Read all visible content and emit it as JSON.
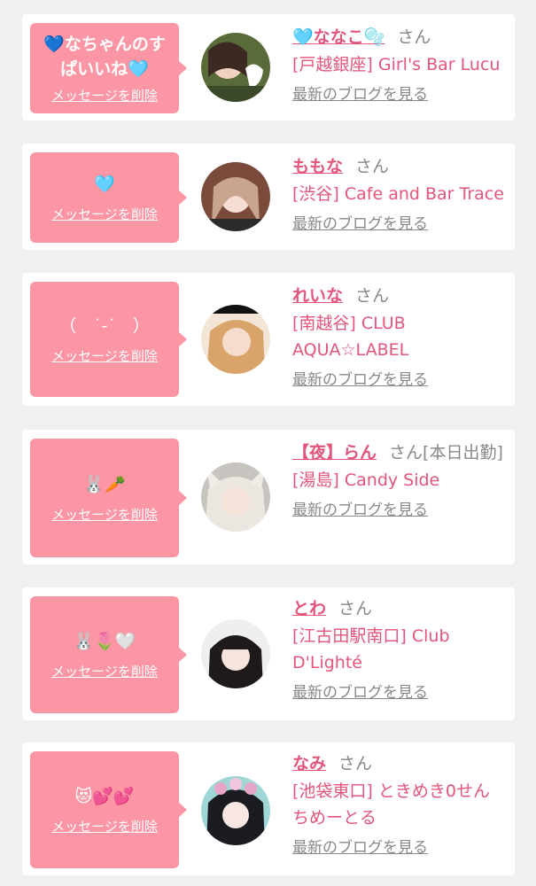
{
  "entries": [
    {
      "message": "💙なちゃんのすぱいいね🩵",
      "delete_label": "メッセージを削除",
      "name": "🩵ななこ🫧",
      "honorific": "さん",
      "extra": "",
      "shop": "[戸越銀座] Girl's Bar Lucu",
      "blog_label": "最新のブログを見る"
    },
    {
      "message": "🩵",
      "delete_label": "メッセージを削除",
      "name": "ももな",
      "honorific": "さん",
      "extra": "",
      "shop": "[渋谷] Cafe and Bar Trace",
      "blog_label": "最新のブログを見る"
    },
    {
      "message": "（　˙-˙　）",
      "delete_label": "メッセージを削除",
      "name": "れいな",
      "honorific": "さん",
      "extra": "",
      "shop": "[南越谷] CLUB AQUA☆LABEL",
      "blog_label": "最新のブログを見る"
    },
    {
      "message": "🐰🥕",
      "delete_label": "メッセージを削除",
      "name": "【夜】らん",
      "honorific": "さん",
      "extra": "[本日出勤]",
      "shop": "[湯島] Candy Side",
      "blog_label": "最新のブログを見る"
    },
    {
      "message": "🐰🌷🤍",
      "delete_label": "メッセージを削除",
      "name": "とわ",
      "honorific": "さん",
      "extra": "",
      "shop": "[江古田駅南口] Club D'Lighté",
      "blog_label": "最新のブログを見る"
    },
    {
      "message": "😻💕💕",
      "delete_label": "メッセージを削除",
      "name": "なみ",
      "honorific": "さん",
      "extra": "",
      "shop": "[池袋東口] ときめき0せんちめーとる",
      "blog_label": "最新のブログを見る"
    }
  ],
  "colors": {
    "bubble": "#fc95a4",
    "accent": "#e3557a",
    "background": "#f0f0f2"
  }
}
